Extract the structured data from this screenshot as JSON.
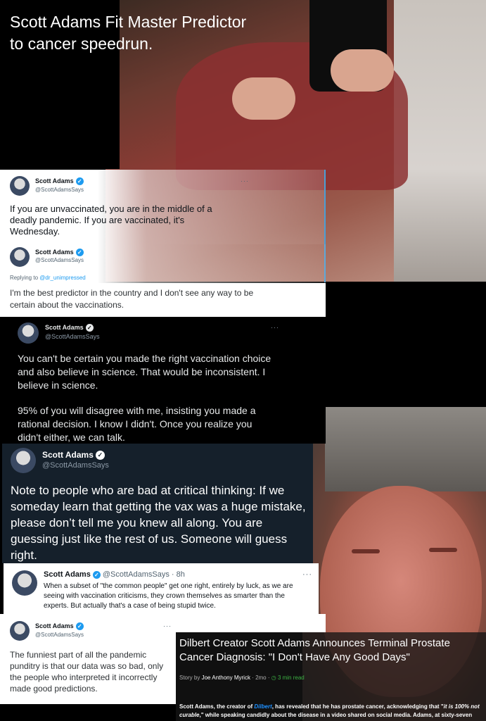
{
  "title": "Scott Adams Fit Master Predictor\nto cancer speedrun.",
  "tweets": [
    {
      "name": "Scott Adams",
      "handle": "@ScottAdamsSays",
      "text": "If you are unvaccinated, you are in the middle of a deadly pandemic. If you are vaccinated, it's Wednesday.",
      "more": "···"
    },
    {
      "name": "Scott Adams",
      "handle": "@ScottAdamsSays",
      "replying_prefix": "Replying to ",
      "replying_to": "@dr_unimpressed",
      "text": "I'm the best predictor in the country and I don't see any way to be certain about the vaccinations."
    },
    {
      "name": "Scott Adams",
      "handle": "@ScottAdamsSays",
      "text1": "You can't be certain you made the right vaccination choice and also believe in science. That would be inconsistent. I believe in science.",
      "text2": "95% of you will disagree with me, insisting you made a rational decision. I know I didn't. Once you realize you didn't either, we can talk.",
      "more": "···"
    },
    {
      "name": "Scott Adams",
      "handle": "@ScottAdamsSays",
      "text": "Note to people who are bad at critical thinking: If we someday learn that getting the vax was a huge mistake, please don’t tell me you knew all along. You are guessing just like the rest of us. Someone will guess right."
    },
    {
      "name": "Scott Adams",
      "handle": "@ScottAdamsSays · 8h",
      "text": "When a subset of \"the common people\" get one right, entirely by luck, as we are seeing with vaccination criticisms, they crown themselves as smarter than the experts. But actually that's a case of being stupid twice.",
      "more": "···"
    },
    {
      "name": "Scott Adams",
      "handle": "@ScottAdamsSays",
      "text": "The funniest part of all the pandemic punditry is that our data was so bad, only the people who interpreted it incorrectly made good predictions.",
      "more": "···"
    }
  ],
  "article": {
    "title": "Dilbert Creator Scott Adams Announces Terminal Prostate Cancer Diagnosis: \"I Don't Have Any Good Days\"",
    "byline_prefix": "Story by ",
    "author": "Joe Anthony Myrick",
    "age": " · 2mo · ",
    "read_time": "3 min read",
    "text_1": "Scott Adams, the creator of ",
    "strip": "Dilbert",
    "text_2": ", has revealed that he has prostate cancer, acknowledging that \"",
    "quote": "it is 100% not curable",
    "text_3": ",\" while speaking candidly about the disease in a video shared on social media. Adams, at sixty-seven"
  },
  "colors": {
    "verified": "#1d9bf0",
    "navy": "#15202b",
    "link": "#1d9bf0"
  }
}
